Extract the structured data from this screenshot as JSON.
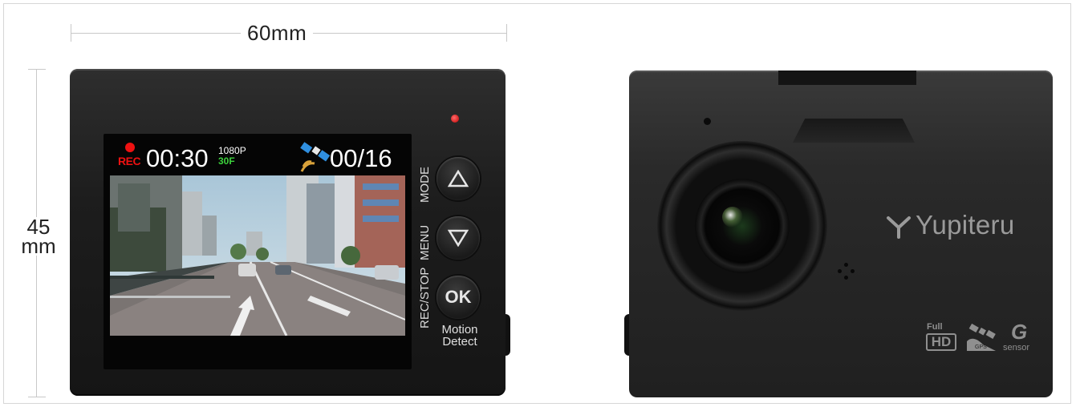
{
  "dimensions": {
    "width_label": "60mm",
    "height_value": "45",
    "height_unit": "mm"
  },
  "back_view": {
    "screen": {
      "rec_label": "REC",
      "elapsed_time": "00:30",
      "resolution": "1080P",
      "frame_rate": "30F",
      "satellite_count": "00/16"
    },
    "buttons": {
      "mode_label": "MODE",
      "menu_label": "MENU",
      "rec_stop_label": "REC/STOP",
      "ok_label": "OK",
      "motion_detect_line1": "Motion",
      "motion_detect_line2": "Detect"
    },
    "led_color": "#e01010"
  },
  "front_view": {
    "brand": "Yupiteru",
    "badges": {
      "full": "Full",
      "hd": "HD",
      "gps": "GPS",
      "g": "G",
      "sensor": "sensor"
    }
  },
  "colors": {
    "body": "#1d1d1d",
    "rec_red": "#ee1111",
    "fps_green": "#3cd23c",
    "satellite_blue": "#2f8fe0",
    "brand_gray": "#9a9a9a"
  },
  "icons": [
    "up-triangle-icon",
    "down-triangle-icon",
    "satellite-icon",
    "yupiteru-logo-icon",
    "gps-satellite-icon"
  ]
}
